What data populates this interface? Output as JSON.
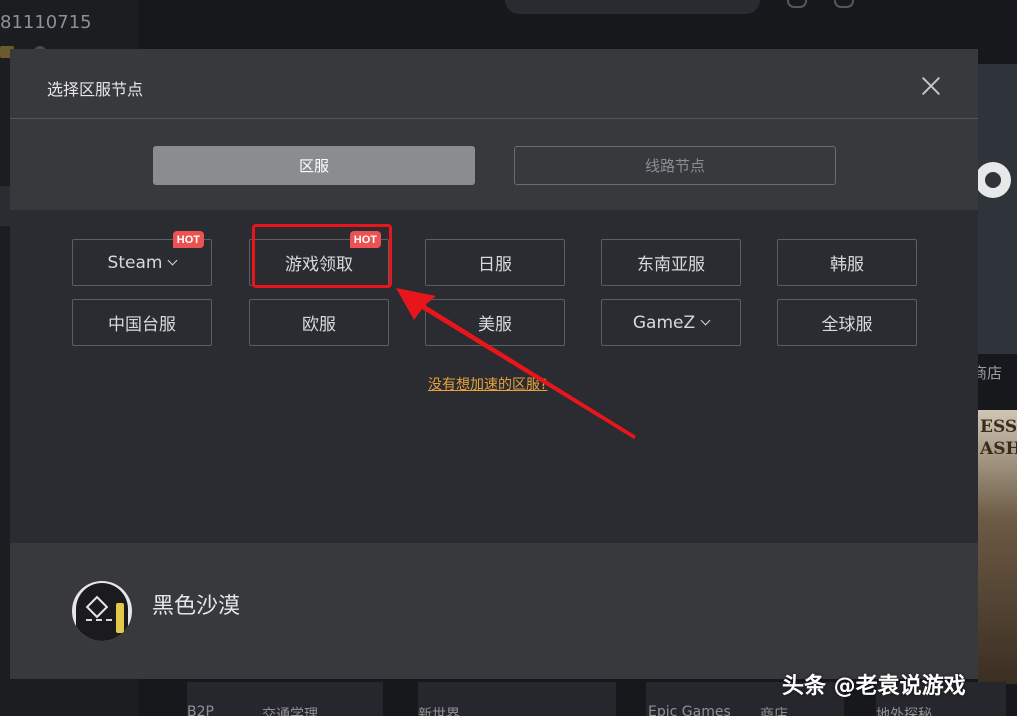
{
  "background": {
    "user_id": "81110715",
    "store_label": "商店",
    "game_title": "ESS ASH",
    "bottom_labels": [
      "B2P",
      "交通学理",
      "新世界",
      "Epic Games",
      "商店",
      "地外探秘"
    ]
  },
  "modal": {
    "title": "选择区服节点",
    "tabs": [
      {
        "label": "区服",
        "active": true
      },
      {
        "label": "线路节点",
        "active": false
      }
    ],
    "regions": [
      {
        "label": "Steam",
        "hot": true,
        "dropdown": true
      },
      {
        "label": "游戏领取",
        "hot": true,
        "dropdown": false
      },
      {
        "label": "日服",
        "hot": false,
        "dropdown": false
      },
      {
        "label": "东南亚服",
        "hot": false,
        "dropdown": false
      },
      {
        "label": "韩服",
        "hot": false,
        "dropdown": false
      },
      {
        "label": "中国台服",
        "hot": false,
        "dropdown": false
      },
      {
        "label": "欧服",
        "hot": false,
        "dropdown": false
      },
      {
        "label": "美服",
        "hot": false,
        "dropdown": false
      },
      {
        "label": "GameZ",
        "hot": false,
        "dropdown": true
      },
      {
        "label": "全球服",
        "hot": false,
        "dropdown": false
      }
    ],
    "hot_label": "HOT",
    "missing_link": "没有想加速的区服?",
    "game": {
      "name": "黑色沙漠"
    }
  },
  "watermark": "头条 @老袁说游戏",
  "colors": {
    "accent_link": "#e6a23c",
    "hot_badge": "#ec5252",
    "annotation": "#e8151b"
  }
}
